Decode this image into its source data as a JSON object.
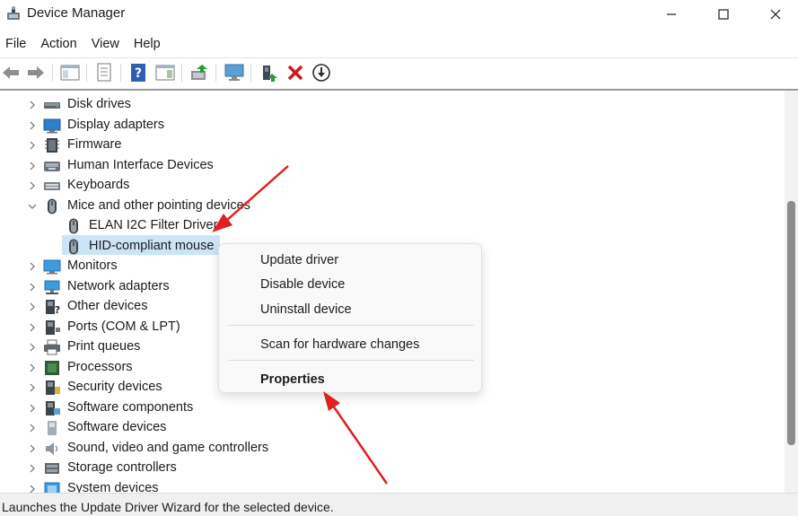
{
  "window": {
    "title": "Device Manager",
    "icons": {
      "app": "device-manager-icon",
      "minimize": "minimize-icon",
      "maximize": "maximize-icon",
      "close": "close-icon"
    }
  },
  "menu": [
    {
      "label": "File"
    },
    {
      "label": "Action"
    },
    {
      "label": "View"
    },
    {
      "label": "Help"
    }
  ],
  "toolbar": {
    "icons": [
      "back-arrow-icon",
      "forward-arrow-icon",
      "show-hide-console-tree-icon",
      "properties-icon",
      "help-icon",
      "action-pane-icon",
      "update-driver-icon",
      "scan-hardware-icon",
      "enable-device-icon",
      "uninstall-device-icon",
      "download-icon"
    ]
  },
  "tree": [
    {
      "label": "Disk drives",
      "icon": "disk-drive-icon",
      "expanded": false
    },
    {
      "label": "Display adapters",
      "icon": "display-adapter-icon",
      "expanded": false
    },
    {
      "label": "Firmware",
      "icon": "firmware-icon",
      "expanded": false
    },
    {
      "label": "Human Interface Devices",
      "icon": "hid-icon",
      "expanded": false
    },
    {
      "label": "Keyboards",
      "icon": "keyboard-icon",
      "expanded": false
    },
    {
      "label": "Mice and other pointing devices",
      "icon": "mouse-icon",
      "expanded": true,
      "children": [
        {
          "label": "ELAN I2C Filter Driver",
          "icon": "mouse-icon"
        },
        {
          "label": "HID-compliant mouse",
          "icon": "mouse-icon",
          "selected": true
        }
      ]
    },
    {
      "label": "Monitors",
      "icon": "monitor-icon",
      "expanded": false
    },
    {
      "label": "Network adapters",
      "icon": "network-adapter-icon",
      "expanded": false
    },
    {
      "label": "Other devices",
      "icon": "other-devices-icon",
      "expanded": false
    },
    {
      "label": "Ports (COM & LPT)",
      "icon": "port-icon",
      "expanded": false
    },
    {
      "label": "Print queues",
      "icon": "printer-icon",
      "expanded": false
    },
    {
      "label": "Processors",
      "icon": "processor-icon",
      "expanded": false
    },
    {
      "label": "Security devices",
      "icon": "security-device-icon",
      "expanded": false
    },
    {
      "label": "Software components",
      "icon": "software-component-icon",
      "expanded": false
    },
    {
      "label": "Software devices",
      "icon": "software-device-icon",
      "expanded": false
    },
    {
      "label": "Sound, video and game controllers",
      "icon": "speaker-icon",
      "expanded": false
    },
    {
      "label": "Storage controllers",
      "icon": "storage-controller-icon",
      "expanded": false
    },
    {
      "label": "System devices",
      "icon": "system-device-icon",
      "expanded": false
    }
  ],
  "context_menu": {
    "update_driver": "Update driver",
    "disable_device": "Disable device",
    "uninstall_device": "Uninstall device",
    "scan_hardware": "Scan for hardware changes",
    "properties": "Properties"
  },
  "status": {
    "text": "Launches the Update Driver Wizard for the selected device."
  },
  "colors": {
    "selection": "#cce4f7",
    "annotation_arrow": "#e0201e",
    "context_bg": "#f9f9f9"
  }
}
